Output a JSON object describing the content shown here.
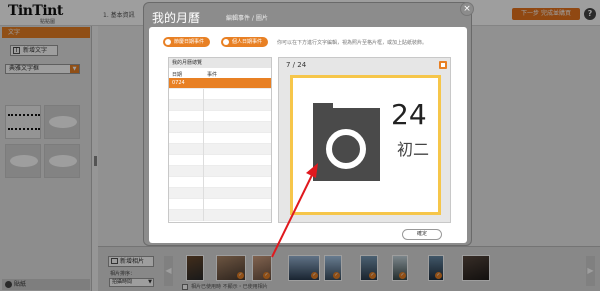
{
  "app": {
    "logo": "TinTint",
    "logo_sub": "點點圖",
    "step": "1. 基本資訊",
    "next_button": "下一步 完成並購買",
    "help_icon": "help-icon"
  },
  "sidebar": {
    "header": "文字",
    "add_text": "新增文字",
    "font_select": "典雅文字框",
    "sticker_tab": "貼紙"
  },
  "tray": {
    "add_photo": "新增相片",
    "sort_label": "相片排序：",
    "sort_value": "拍攝時間",
    "check_label": "相片已使用時 不顯示・已使用相片"
  },
  "modal": {
    "title": "我的月曆",
    "crumb": "編輯事件 / 圖片",
    "pill_holiday": "節慶日期事件",
    "pill_personal": "個人日期事件",
    "hint": "你可以在下方進行文字編輯，視為照片至格片框，或加上貼紙裝飾。",
    "list_title": "我的月曆總覽",
    "col_date": "日期",
    "col_event": "事件",
    "selected_row": "0724",
    "preview_title": "7 / 24",
    "day_number": "24",
    "lunar_day": "初二",
    "ok_button": "確定"
  },
  "colors": {
    "accent": "#e88024",
    "frame": "#f6c64a",
    "arrow": "#e0191e"
  }
}
